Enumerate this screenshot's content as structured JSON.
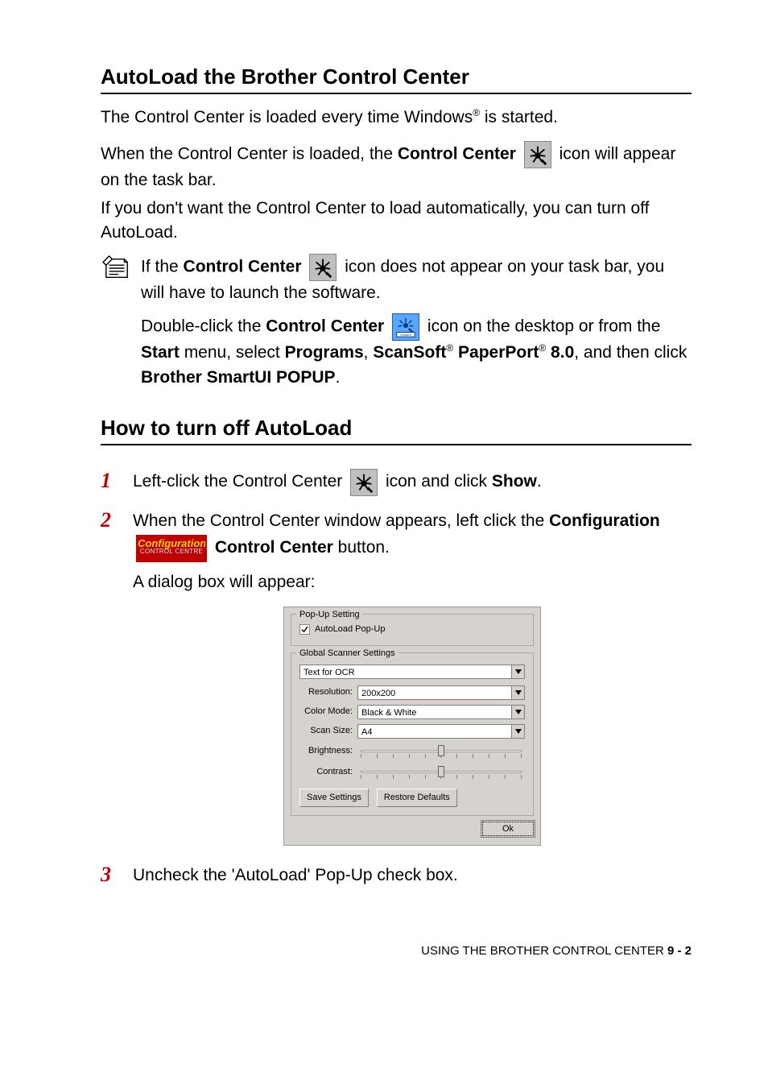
{
  "heading1": "AutoLoad the Brother Control Center",
  "p1_a": "The Control Center is loaded every time Windows",
  "p1_b": " is started.",
  "p2_a": "When the Control Center is loaded, the ",
  "p2_bold": "Control Center",
  "p2_c": " icon will appear on the task bar.",
  "p3": "If you don't want the Control Center to load automatically, you can turn off AutoLoad.",
  "note1_a": "If the ",
  "note1_bold": "Control Center",
  "note1_b": " icon does not appear on your task bar, you will have to launch the software.",
  "note2_a": "Double-click the ",
  "note2_bold1": "Control Center",
  "note2_b": " icon on the desktop or from the ",
  "note2_bold2": "Start",
  "note2_c": " menu, select ",
  "note2_bold3": "Programs",
  "note2_d": ", ",
  "note2_bold4": "ScanSoft",
  "note2_bold5": " PaperPort",
  "note2_bold6": " 8.0",
  "note2_e": ", and then click ",
  "note2_bold7": "Brother SmartUI POPUP",
  "note2_f": ".",
  "heading2": "How to turn off AutoLoad",
  "step1_a": "Left-click the Control Center ",
  "step1_b": " icon and click ",
  "step1_bold": "Show",
  "step1_c": ".",
  "step2_a": "When the Control Center window appears, left click the ",
  "step2_bold1": "Configuration",
  "step2_bold2": " Control Center",
  "step2_b": " button.",
  "step2_c": "A dialog box will appear:",
  "step3": "Uncheck the 'AutoLoad' Pop-Up check box.",
  "config_badge_top": "Configuration",
  "config_badge_bottom": "CONTROL CENTRE",
  "dialog": {
    "group1": "Pop-Up Setting",
    "autoload": "AutoLoad Pop-Up",
    "group2": "Global Scanner Settings",
    "preset": "Text for OCR",
    "res_label": "Resolution:",
    "res_val": "200x200",
    "color_label": "Color Mode:",
    "color_val": "Black & White",
    "scan_label": "Scan Size:",
    "scan_val": "A4",
    "brightness": "Brightness:",
    "contrast": "Contrast:",
    "save": "Save Settings",
    "restore": "Restore Defaults",
    "ok": "Ok"
  },
  "footer_a": "USING THE BROTHER CONTROL CENTER   ",
  "footer_b": "9 - 2"
}
